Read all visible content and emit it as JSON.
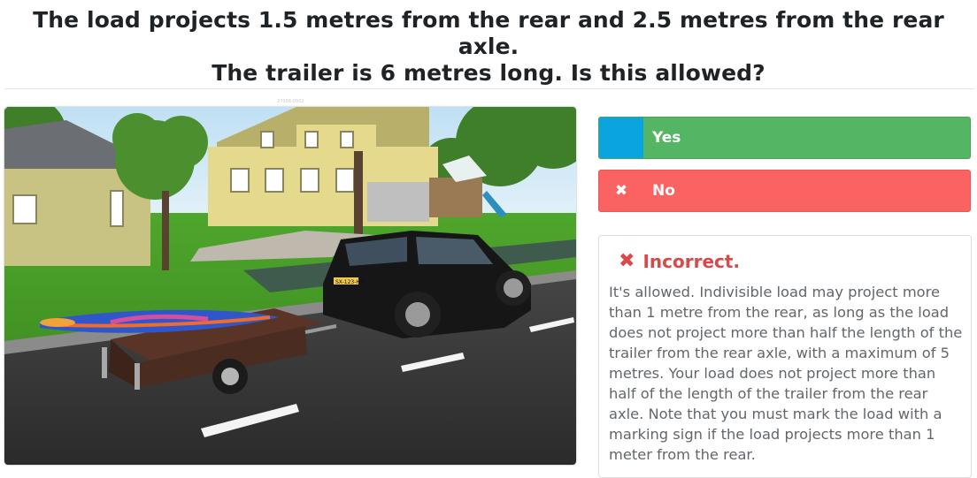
{
  "question": {
    "line1": "The load projects 1.5 metres from the rear and 2.5 metres from the rear axle.",
    "line2": "The trailer is 6 metres long. Is this allowed?"
  },
  "image": {
    "caption": "27006-0002",
    "plate": "SX-123-HB"
  },
  "answers": [
    {
      "label": "Yes",
      "state": "correct",
      "marker_icon": "",
      "color": "#54b665",
      "marker_color": "#0aa4e0"
    },
    {
      "label": "No",
      "state": "selected-wrong",
      "marker_icon": "✖",
      "color": "#fb6262"
    }
  ],
  "feedback": {
    "status_icon": "✖",
    "status": "Incorrect.",
    "status_color": "#d84949",
    "text": "It's allowed. Indivisible load may project more than 1 metre from the rear, as long as the load does not project more than half the length of the trailer from the rear axle, with a maximum of 5 metres. Your load does not project more than half of the length of the trailer from the rear axle. Note that you must mark the load with a marking sign if the load projects more than 1 meter from the rear."
  }
}
